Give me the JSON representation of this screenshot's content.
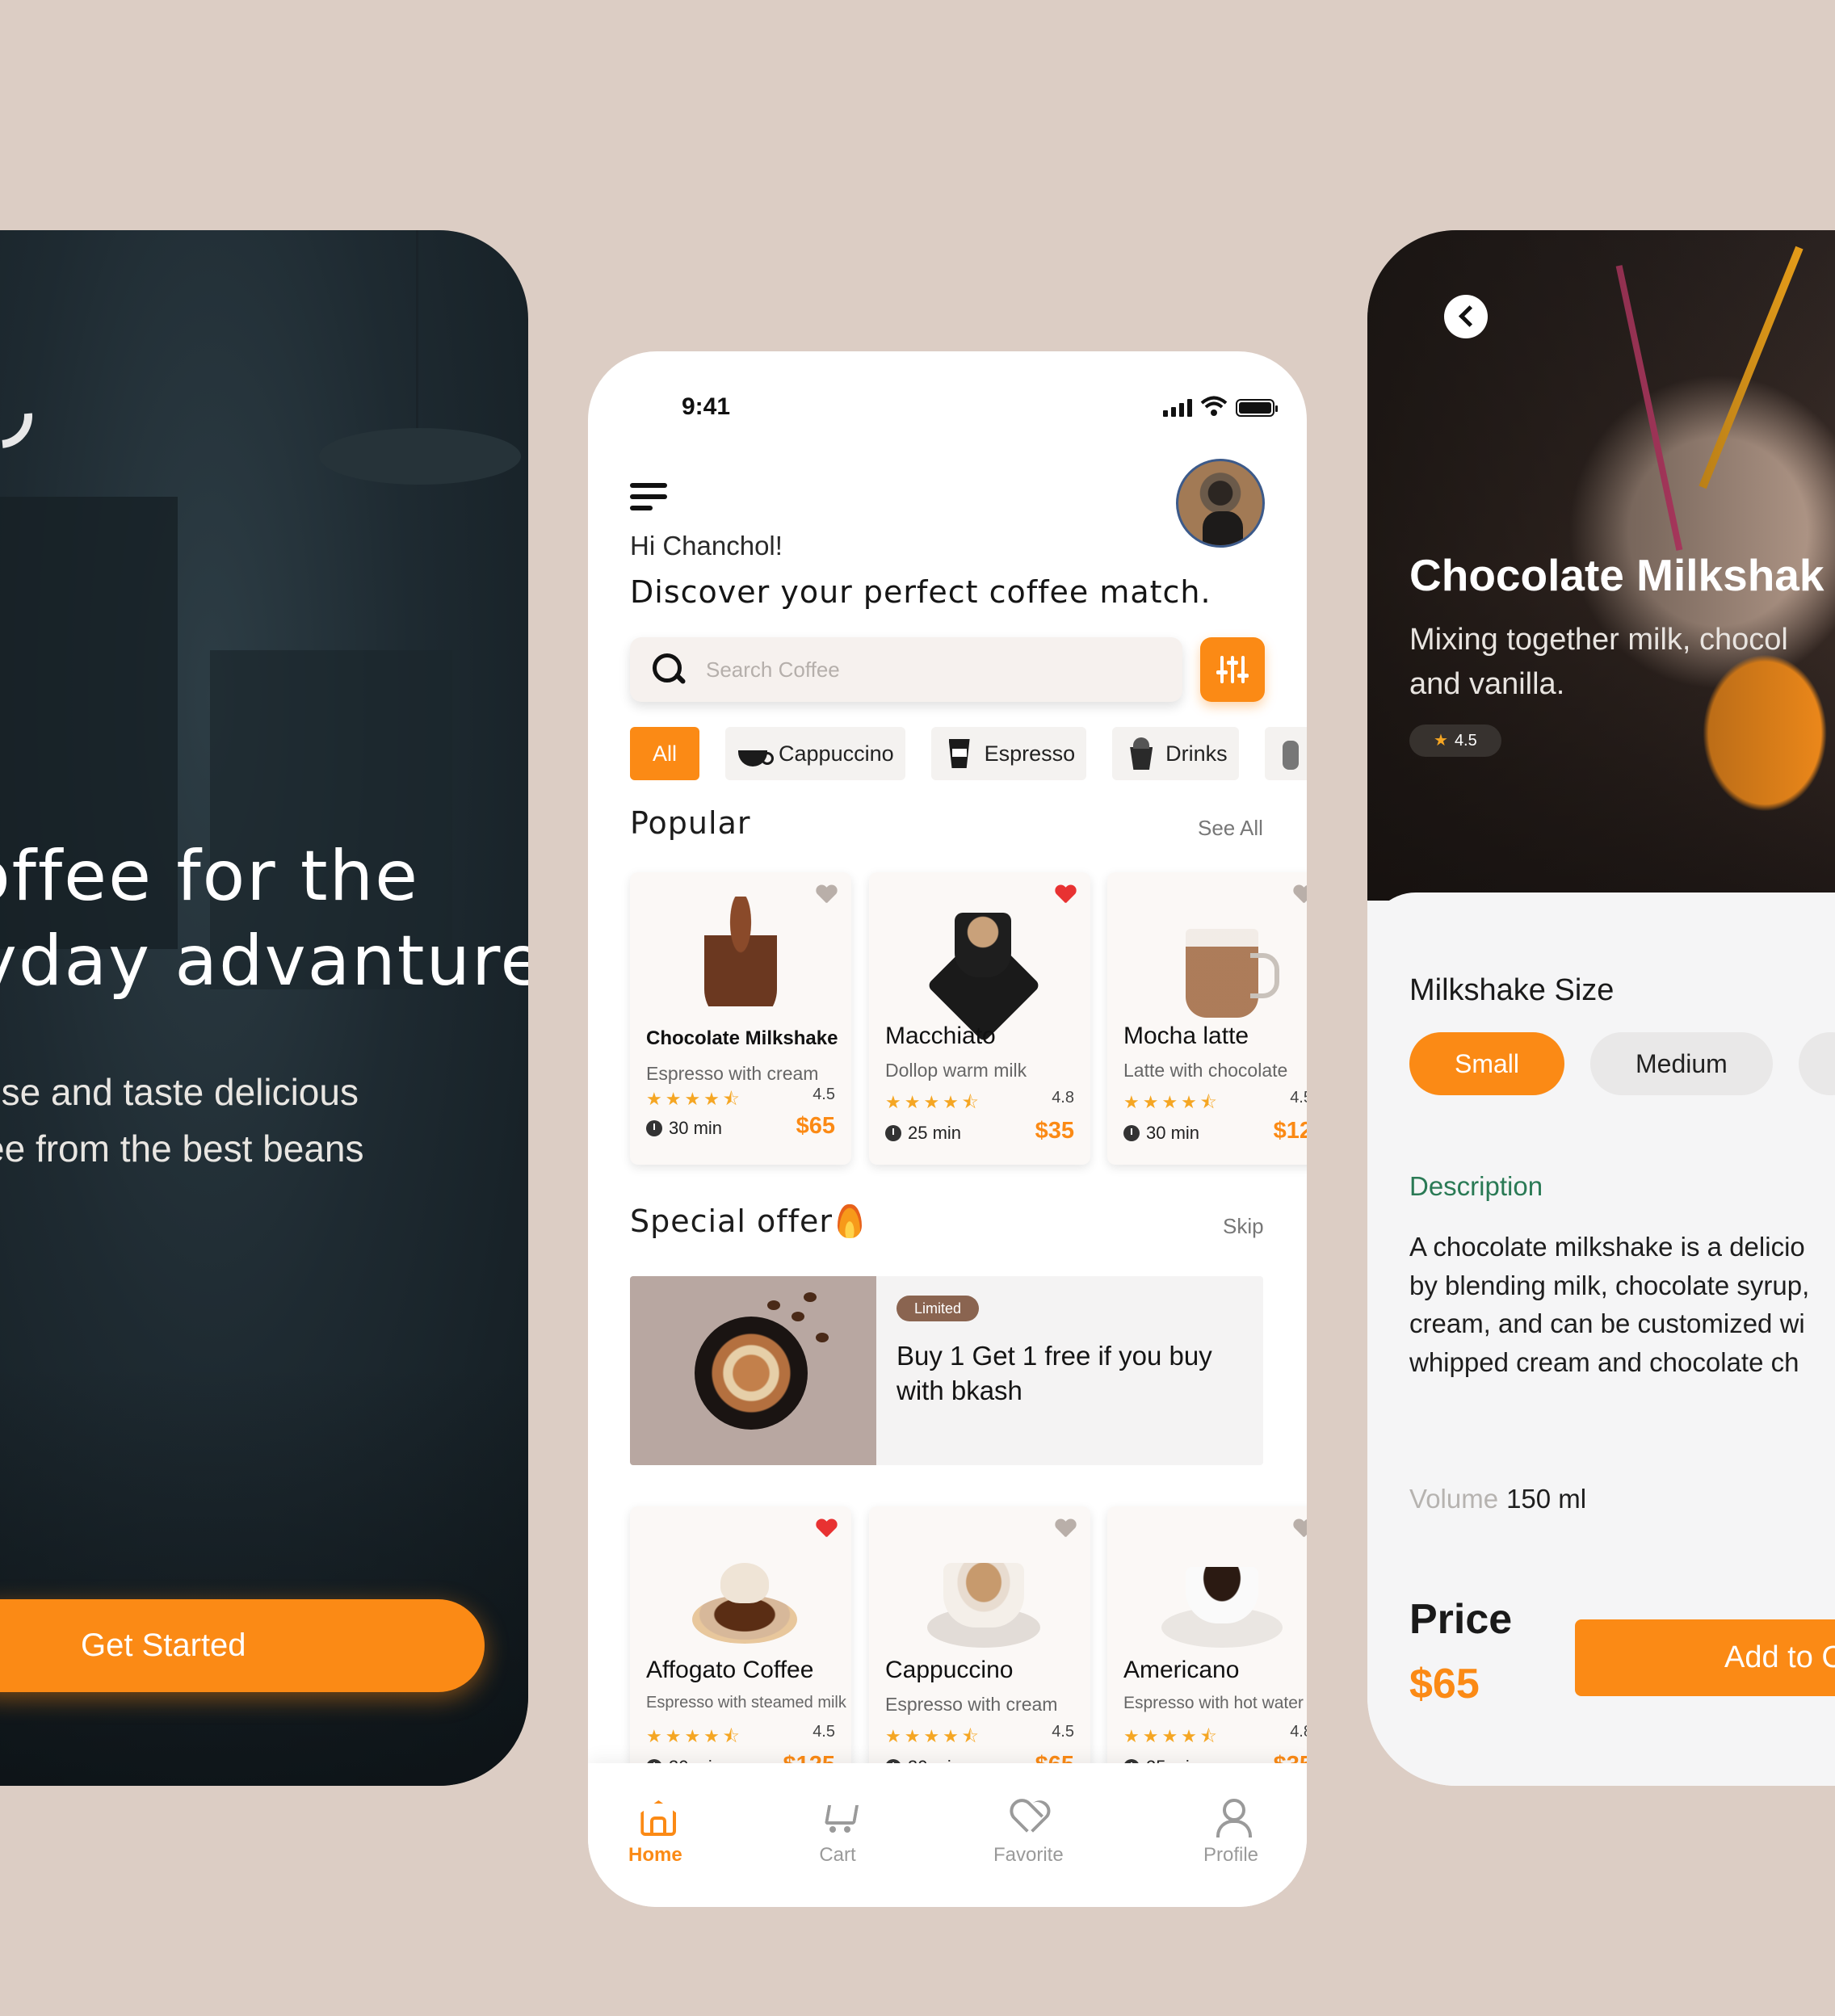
{
  "onboarding": {
    "title_line1": "offee for the",
    "title_line2": "yday advanture",
    "subtitle_line1": "ose and taste delicious",
    "subtitle_line2": "ee from the best beans",
    "cta_label": "Get Started"
  },
  "home": {
    "status_time": "9:41",
    "greeting": "Hi Chanchol!",
    "headline": "Discover your perfect coffee match.",
    "search_placeholder": "Search Coffee",
    "categories": [
      {
        "label": "All",
        "icon": "all"
      },
      {
        "label": "Cappuccino",
        "icon": "cappuccino-cup-icon"
      },
      {
        "label": "Espresso",
        "icon": "espresso-cup-icon"
      },
      {
        "label": "Drinks",
        "icon": "drinks-cup-icon"
      }
    ],
    "popular": {
      "title": "Popular",
      "link": "See All",
      "items": [
        {
          "name": "Chocolate Milkshake",
          "desc": "Espresso with cream",
          "stars": "★★★★⯪",
          "rating": "4.5",
          "time": "30 min",
          "price": "$65",
          "favorite": false
        },
        {
          "name": "Macchiato",
          "desc": "Dollop warm milk",
          "stars": "★★★★⯪",
          "rating": "4.8",
          "time": "25 min",
          "price": "$35",
          "favorite": true
        },
        {
          "name": "Mocha latte",
          "desc": "Latte with chocolate",
          "stars": "★★★★⯪",
          "rating": "4.5",
          "time": "30 min",
          "price": "$12",
          "favorite": false
        }
      ]
    },
    "special": {
      "title": "Special offer",
      "link": "Skip",
      "badge": "Limited",
      "text": "Buy 1 Get 1 free if you buy with bkash"
    },
    "more_items": [
      {
        "name": "Affogato Coffee",
        "desc": "Espresso with steamed milk",
        "stars": "★★★★⯪",
        "rating": "4.5",
        "time": "30 min",
        "price": "$125",
        "favorite": true
      },
      {
        "name": "Cappuccino",
        "desc": "Espresso with cream",
        "stars": "★★★★⯪",
        "rating": "4.5",
        "time": "30 min",
        "price": "$65",
        "favorite": false
      },
      {
        "name": "Americano",
        "desc": "Espresso with hot water",
        "stars": "★★★★⯪",
        "rating": "4.8",
        "time": "25 min",
        "price": "$35",
        "favorite": false
      }
    ],
    "nav": [
      {
        "label": "Home",
        "icon": "home-icon",
        "active": true
      },
      {
        "label": "Cart",
        "icon": "cart-icon",
        "active": false
      },
      {
        "label": "Favorite",
        "icon": "heart-icon",
        "active": false
      },
      {
        "label": "Profile",
        "icon": "profile-icon",
        "active": false
      }
    ]
  },
  "detail": {
    "title": "Chocolate Milkshak",
    "subtitle_line1": "Mixing together milk, chocol",
    "subtitle_line2": "and vanilla.",
    "rating": "4.5",
    "size_label": "Milkshake Size",
    "sizes": [
      "Small",
      "Medium"
    ],
    "selected_size": "Small",
    "description_label": "Description",
    "description_lines": [
      "A chocolate milkshake is a delicio",
      "by blending milk, chocolate syrup,",
      "cream, and can be customized wi",
      "whipped cream and chocolate ch"
    ],
    "volume_label": "Volume",
    "volume_value": "150 ml",
    "price_label": "Price",
    "price_value": "$65",
    "add_label": "Add to C"
  },
  "colors": {
    "background": "#dccdc4",
    "accent": "#fb8a15",
    "favorite_red": "#e83232",
    "description_green": "#2a7a55"
  }
}
